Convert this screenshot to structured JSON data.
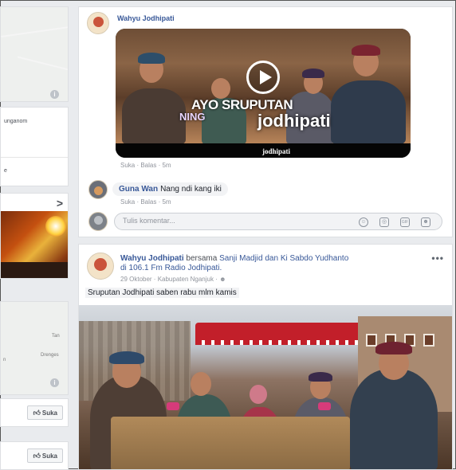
{
  "sidebar": {
    "location_top": "unganom",
    "location_bottom": "e",
    "chevron": ">",
    "map_labels": [
      "Tan",
      "Drenges",
      "n"
    ],
    "like_label": "Suka"
  },
  "comment_reply": {
    "author": "Wahyu Jodhipati",
    "video_overlay_line1": "AYO SRUPUTAN",
    "video_overlay_line2": "NING",
    "video_overlay_brand": "jodhipati",
    "video_footer": "jodhipati",
    "actions": [
      "Suka",
      "Balas",
      "5m"
    ]
  },
  "comment_guna": {
    "author": "Guna Wan",
    "text": "Nang ndi kang iki",
    "actions": [
      "Suka",
      "Balas",
      "5m"
    ]
  },
  "comment_input": {
    "placeholder": "Tulis komentar...",
    "icons": [
      "emoji-icon",
      "camera-icon",
      "gif-icon",
      "sticker-icon"
    ]
  },
  "post": {
    "author": "Wahyu Jodhipati",
    "with": "bersama",
    "tagged": "Sanji Madjid dan Ki Sabdo Yudhanto",
    "location_line": "di 106.1 Fm Radio Jodhipati.",
    "date": "29 Oktober",
    "place": "Kabupaten Nganjuk",
    "caption": "Sruputan Jodhipati saben rabu mlm kamis",
    "more": "•••"
  },
  "colors": {
    "link": "#385898",
    "meta": "#90949c",
    "page_bg": "#e9ebee"
  }
}
